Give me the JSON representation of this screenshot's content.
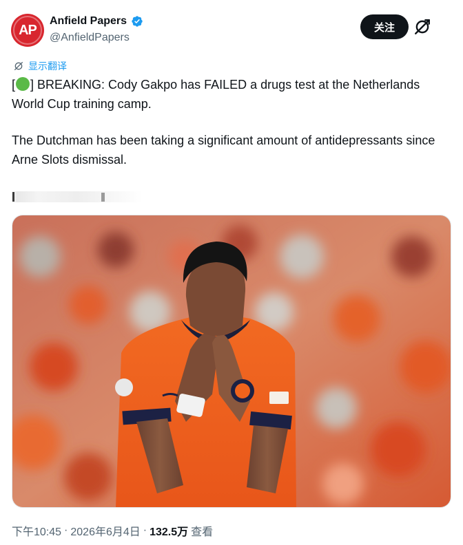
{
  "author": {
    "avatar_text": "AP",
    "display_name": "Anfield Papers",
    "handle": "@AnfieldPapers",
    "verified": true
  },
  "actions": {
    "follow_label": "关注",
    "grok_icon": "grok-icon"
  },
  "translate_label": "显示翻译",
  "tweet": {
    "line1_prefix": "[",
    "line1_rest": "] BREAKING: Cody Gakpo has FAILED a drugs test at the Netherlands World Cup training camp.",
    "line2": "The Dutchman has been taking a significant amount of antidepressants since Arne Slots dismissal."
  },
  "footer": {
    "time": "下午10:45",
    "sep1": "·",
    "date": "2026年6月4日",
    "sep2": "·",
    "views": "132.5万",
    "views_label": "查看"
  },
  "colors": {
    "avatar": "#d8262e",
    "verified": "#1d9bf0",
    "link": "#1d9bf0",
    "jersey": "#f0631c"
  }
}
